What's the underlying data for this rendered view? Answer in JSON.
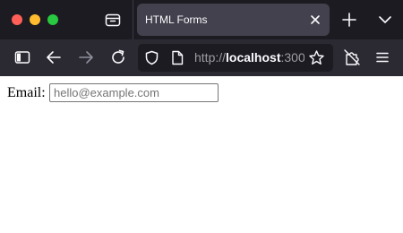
{
  "window": {
    "controls": [
      "close",
      "minimize",
      "zoom"
    ]
  },
  "tabbar": {
    "active_tab": {
      "title": "HTML Forms"
    },
    "icons": {
      "tabs_list": "tab-list-icon",
      "close_tab": "close-icon",
      "new_tab": "plus-icon",
      "all_tabs": "chevron-down-icon"
    }
  },
  "toolbar": {
    "url": {
      "prefix": "http://",
      "host": "localhost",
      "suffix": ":300"
    },
    "icons": {
      "sidebar": "sidebar-icon",
      "back": "back-arrow-icon",
      "forward": "forward-arrow-icon",
      "reload": "reload-icon",
      "tracking_protection": "shield-icon",
      "page_info": "page-icon",
      "bookmark": "star-icon",
      "extensions": "extensions-icon",
      "menu": "hamburger-menu-icon"
    }
  },
  "page": {
    "email_label": "Email:",
    "email_placeholder": "hello@example.com",
    "email_value": ""
  },
  "colors": {
    "tabbar_bg": "#1c1b22",
    "active_tab_bg": "#42414d",
    "navbar_bg": "#2b2a33",
    "urlbar_bg": "#1c1b22",
    "close_button": "#ff5f57",
    "minimize_button": "#febc2e",
    "zoom_button": "#28c840"
  }
}
